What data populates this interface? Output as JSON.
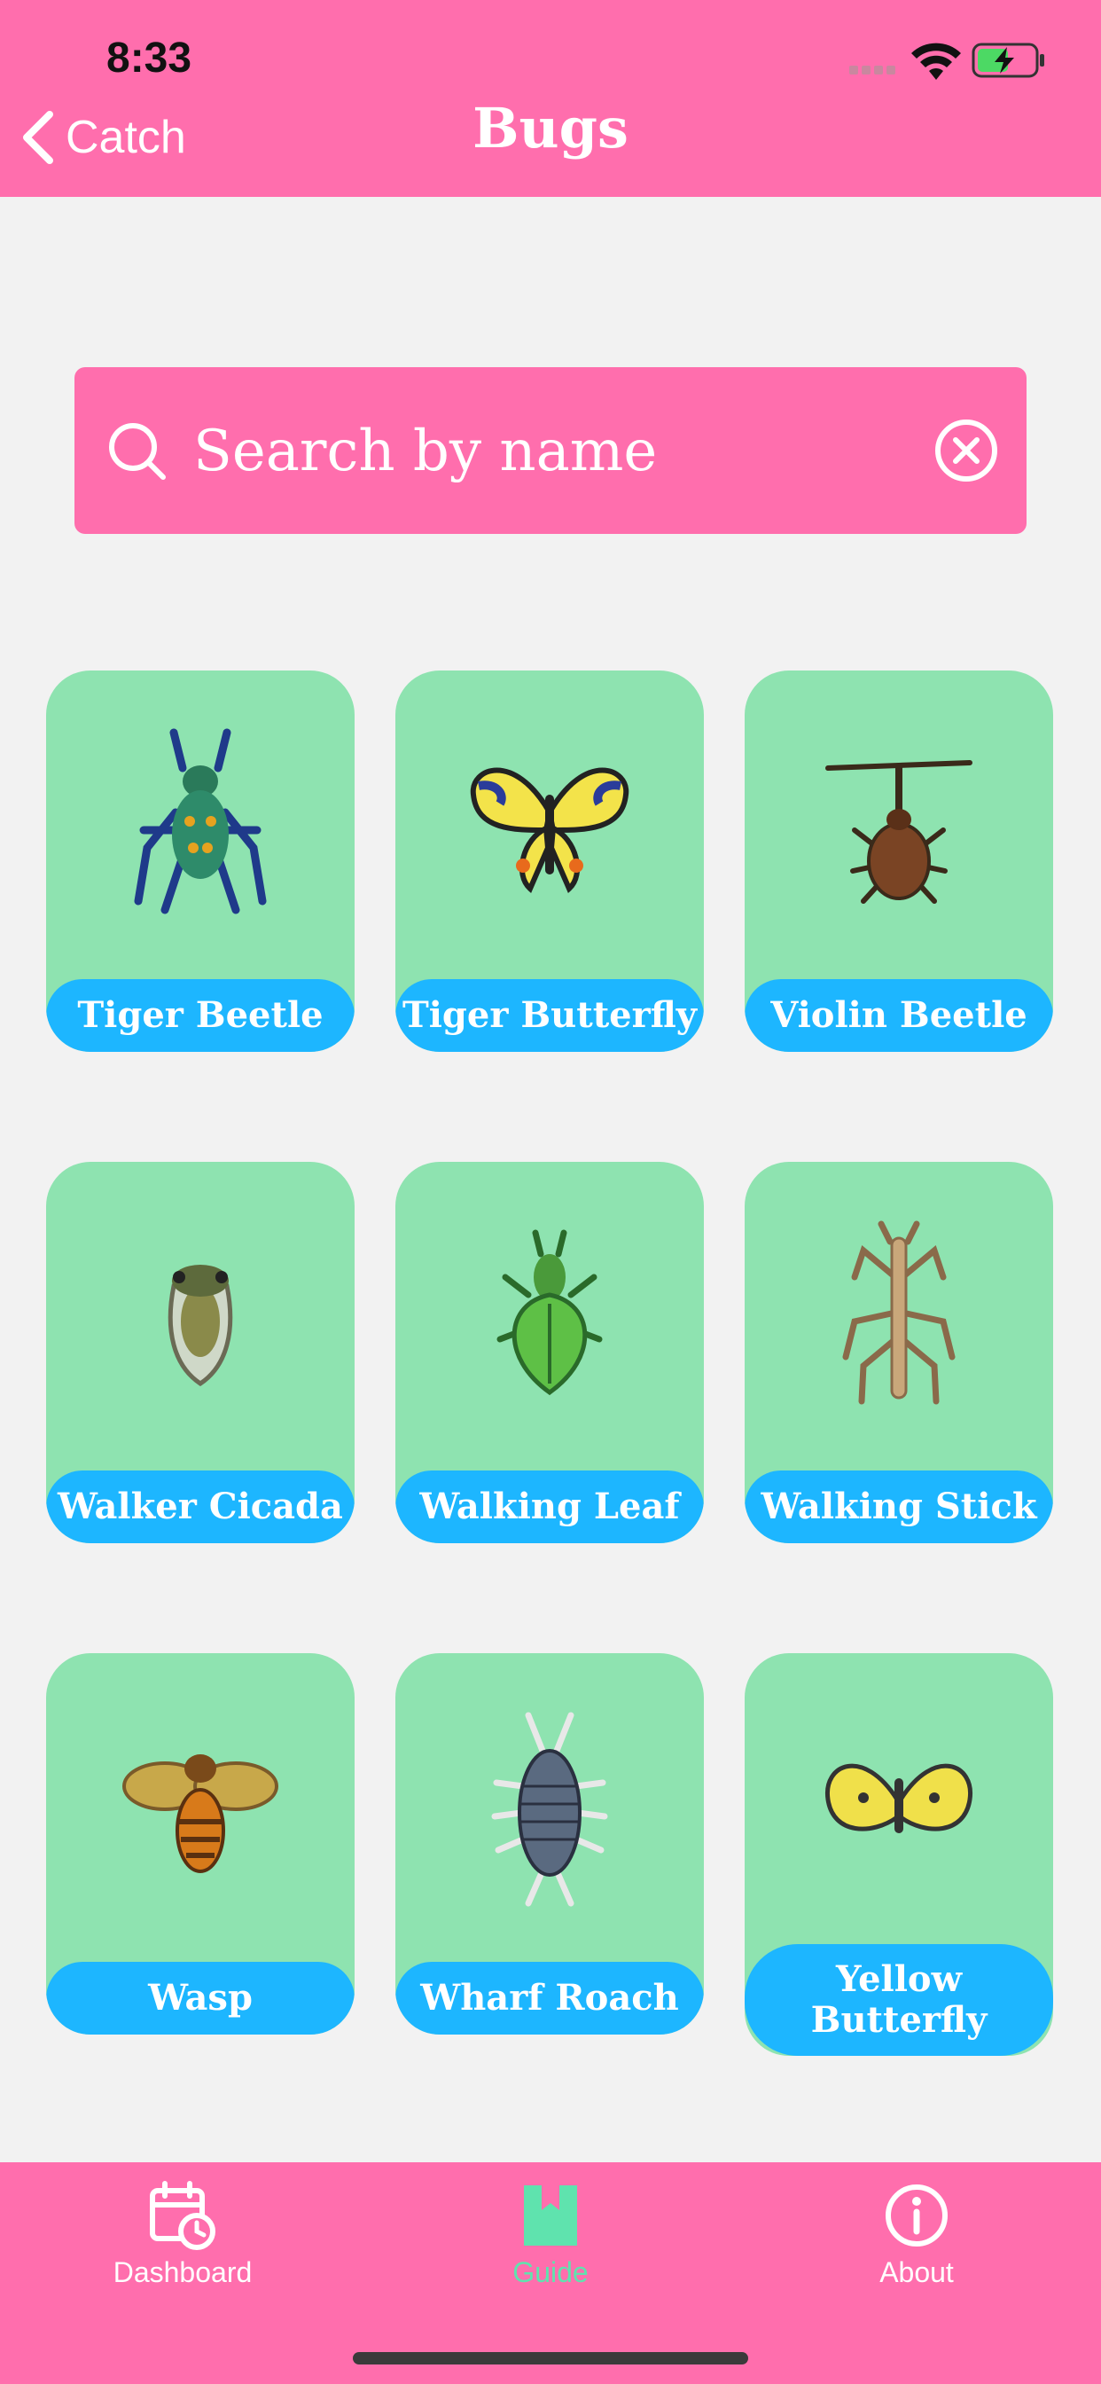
{
  "status": {
    "time": "8:33"
  },
  "nav": {
    "back_label": "Catch",
    "title": "Bugs"
  },
  "search": {
    "placeholder": "Search by name"
  },
  "bugs": [
    {
      "name": "Tiger Beetle",
      "icon": "tiger-beetle-icon"
    },
    {
      "name": "Tiger Butterfly",
      "icon": "tiger-butterfly-icon"
    },
    {
      "name": "Violin Beetle",
      "icon": "violin-beetle-icon"
    },
    {
      "name": "Walker Cicada",
      "icon": "walker-cicada-icon"
    },
    {
      "name": "Walking Leaf",
      "icon": "walking-leaf-icon"
    },
    {
      "name": "Walking Stick",
      "icon": "walking-stick-icon"
    },
    {
      "name": "Wasp",
      "icon": "wasp-icon"
    },
    {
      "name": "Wharf Roach",
      "icon": "wharf-roach-icon"
    },
    {
      "name": "Yellow Butterfly",
      "icon": "yellow-butterfly-icon"
    }
  ],
  "tabs": [
    {
      "label": "Dashboard",
      "icon": "calendar-clock-icon"
    },
    {
      "label": "Guide",
      "icon": "bookmark-book-icon",
      "active": true
    },
    {
      "label": "About",
      "icon": "info-icon"
    }
  ],
  "colors": {
    "brand_pink": "#ff6ead",
    "card_green": "#8ee3b0",
    "label_blue": "#1db6ff",
    "active_tab": "#5fe3ae"
  }
}
